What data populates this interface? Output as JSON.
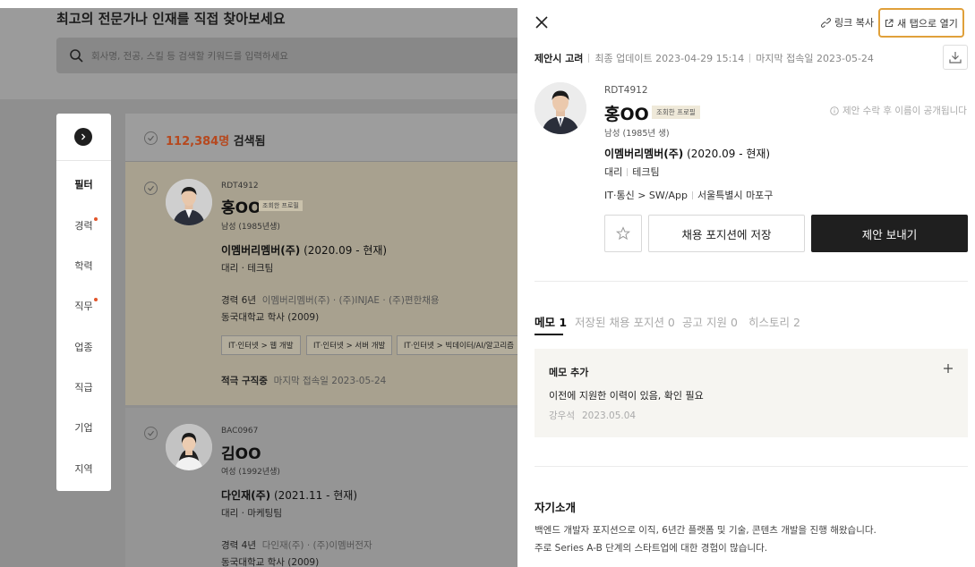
{
  "background": {
    "page_title": "최고의 전문가나 인재를 직접 찾아보세요",
    "search_placeholder": "회사명, 전공, 스킬 등 검색할 키워드를 입력하세요",
    "filters": [
      {
        "label": "필터",
        "dot": false
      },
      {
        "label": "경력",
        "dot": true
      },
      {
        "label": "학력",
        "dot": false
      },
      {
        "label": "직무",
        "dot": true
      },
      {
        "label": "업종",
        "dot": false
      },
      {
        "label": "직급",
        "dot": false
      },
      {
        "label": "기업",
        "dot": false
      },
      {
        "label": "지역",
        "dot": false
      }
    ],
    "result_count": "112,384명",
    "result_suffix": "검색됨",
    "candidates": [
      {
        "id": "RDT4912",
        "name": "홍OO",
        "badge": "조회한 프로필",
        "gender_birth": "남성 (1985년생)",
        "company": "이멤버리멤버(주)",
        "period": "(2020.09 - 현재)",
        "role": "대리",
        "team": "테크팀",
        "career_label": "경력 6년",
        "career_detail": "이멤버리멤버(주) · (주)INJAE · (주)편한채용",
        "education": "동국대학교 학사 (2009)",
        "tags": [
          "IT·인터넷 > 웹 개발",
          "IT·인터넷 > 서버 개발",
          "IT·인터넷 > 빅데이터/AI/알고리즘"
        ],
        "status": "적극 구직중",
        "last_access": "마지막 접속일 2023-05-24"
      },
      {
        "id": "BAC0967",
        "name": "김OO",
        "gender_birth": "여성 (1992년생)",
        "company": "다인재(주)",
        "period": "(2021.11 - 현재)",
        "role": "대리",
        "team": "마케팅팀",
        "career_label": "경력 4년",
        "career_detail": "다인재(주) · (주)이멤버전자",
        "education": "동국대학교 학사 (2009)"
      }
    ]
  },
  "drawer": {
    "link_copy": "링크 복사",
    "open_new_tab": "새 탭으로 열기",
    "meta_status": "제안시 고려",
    "meta_updated": "최종 업데이트 2023-04-29 15:14",
    "meta_access": "마지막 접속일 2023-05-24",
    "profile": {
      "id": "RDT4912",
      "name": "홍OO",
      "badge": "조회한 프로필",
      "notice": "제안 수락 후 이름이 공개됩니다",
      "gender_birth": "남성 (1985년 생)",
      "company": "이멤버리멤버(주)",
      "period": "(2020.09 - 현재)",
      "role": "대리",
      "team": "테크팀",
      "job": "IT·통신 > SW/App",
      "location": "서울특별시 마포구"
    },
    "save_button": "채용 포지션에 저장",
    "offer_button": "제안 보내기",
    "tabs": [
      {
        "label": "메모 1",
        "active": true
      },
      {
        "label": "저장된 채용 포지션 0",
        "active": false
      },
      {
        "label": "공고 지원 0",
        "active": false
      },
      {
        "label": "히스토리 2",
        "active": false
      }
    ],
    "memo": {
      "title": "메모 추가",
      "text": "이전에 지원한 이력이 있음, 확인 필요",
      "author": "강우석",
      "date": "2023.05.04"
    },
    "intro": {
      "title": "자기소개",
      "lines": [
        "백엔드 개발자 포지션으로 이직, 6년간 플랫폼 및 기술, 콘텐츠 개발을 진행 해왔습니다.",
        "주로 Series A-B 단계의 스타트업에 대한 경험이 많습니다."
      ]
    }
  },
  "colors": {
    "accent_highlight": "#e0a03a",
    "count_color": "#b6481e",
    "filter_dot": "#e2552a",
    "primary_button": "#1f1f1f"
  }
}
